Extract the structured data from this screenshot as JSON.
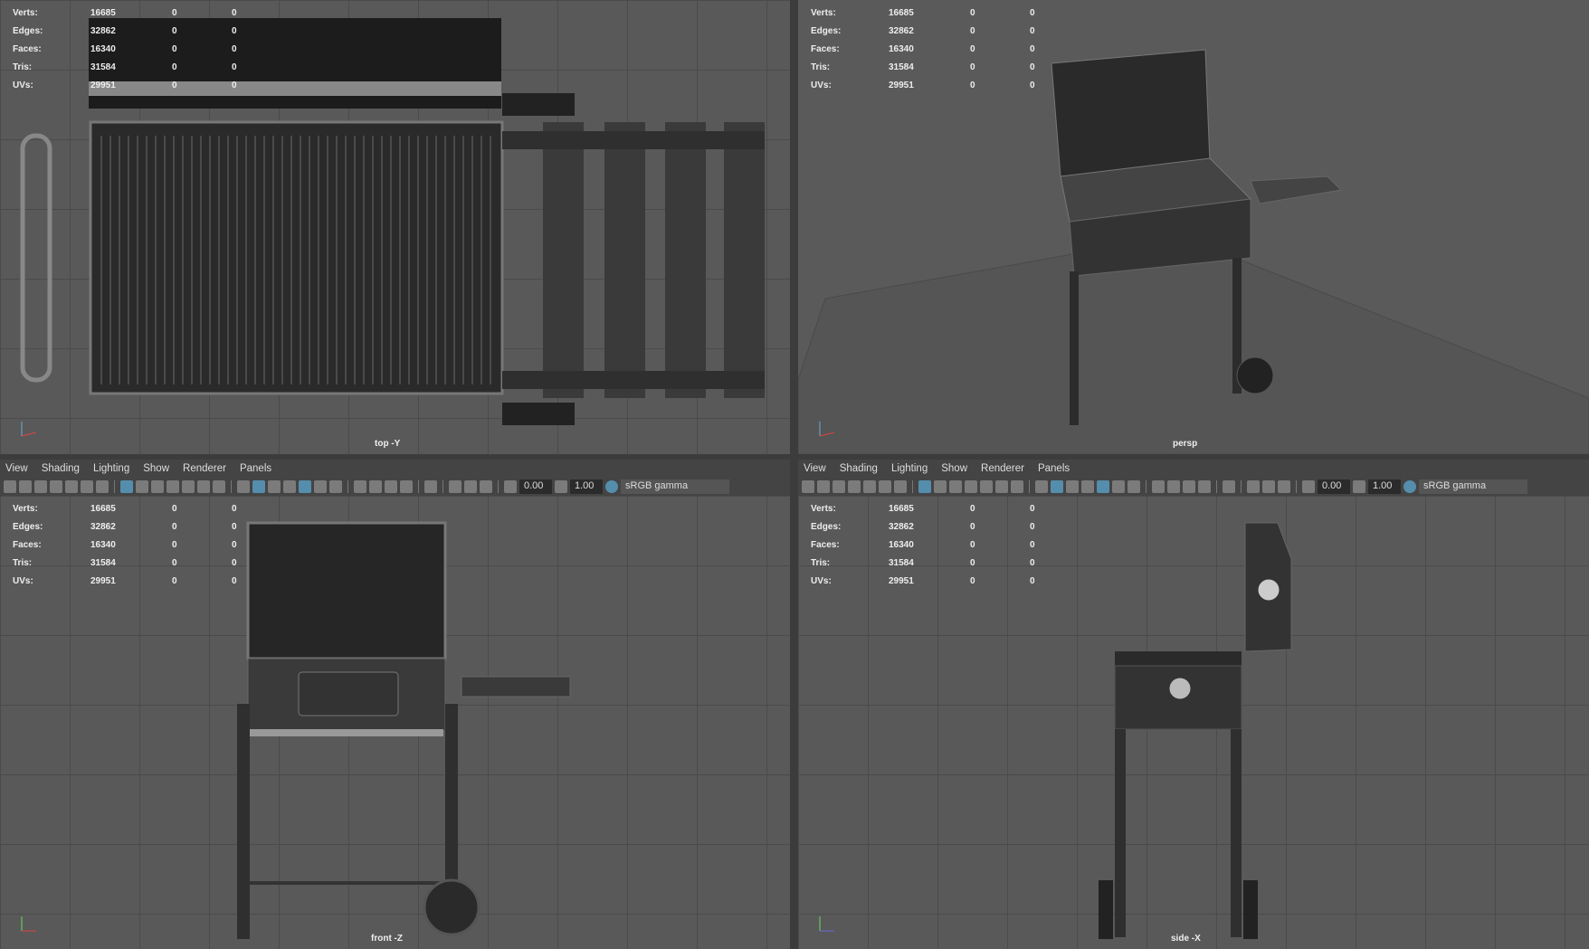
{
  "menu": [
    "View",
    "Shading",
    "Lighting",
    "Show",
    "Renderer",
    "Panels"
  ],
  "toolbar": {
    "exposure": "0.00",
    "gamma": "1.00",
    "color_space": "sRGB gamma"
  },
  "stats_labels": [
    "Verts:",
    "Edges:",
    "Faces:",
    "Tris:",
    "UVs:"
  ],
  "stats_values": [
    [
      "16685",
      "0",
      "0"
    ],
    [
      "32862",
      "0",
      "0"
    ],
    [
      "16340",
      "0",
      "0"
    ],
    [
      "31584",
      "0",
      "0"
    ],
    [
      "29951",
      "0",
      "0"
    ]
  ],
  "viewports": [
    {
      "label": "top -Y"
    },
    {
      "label": "persp"
    },
    {
      "label": "front -Z"
    },
    {
      "label": "side -X"
    }
  ]
}
